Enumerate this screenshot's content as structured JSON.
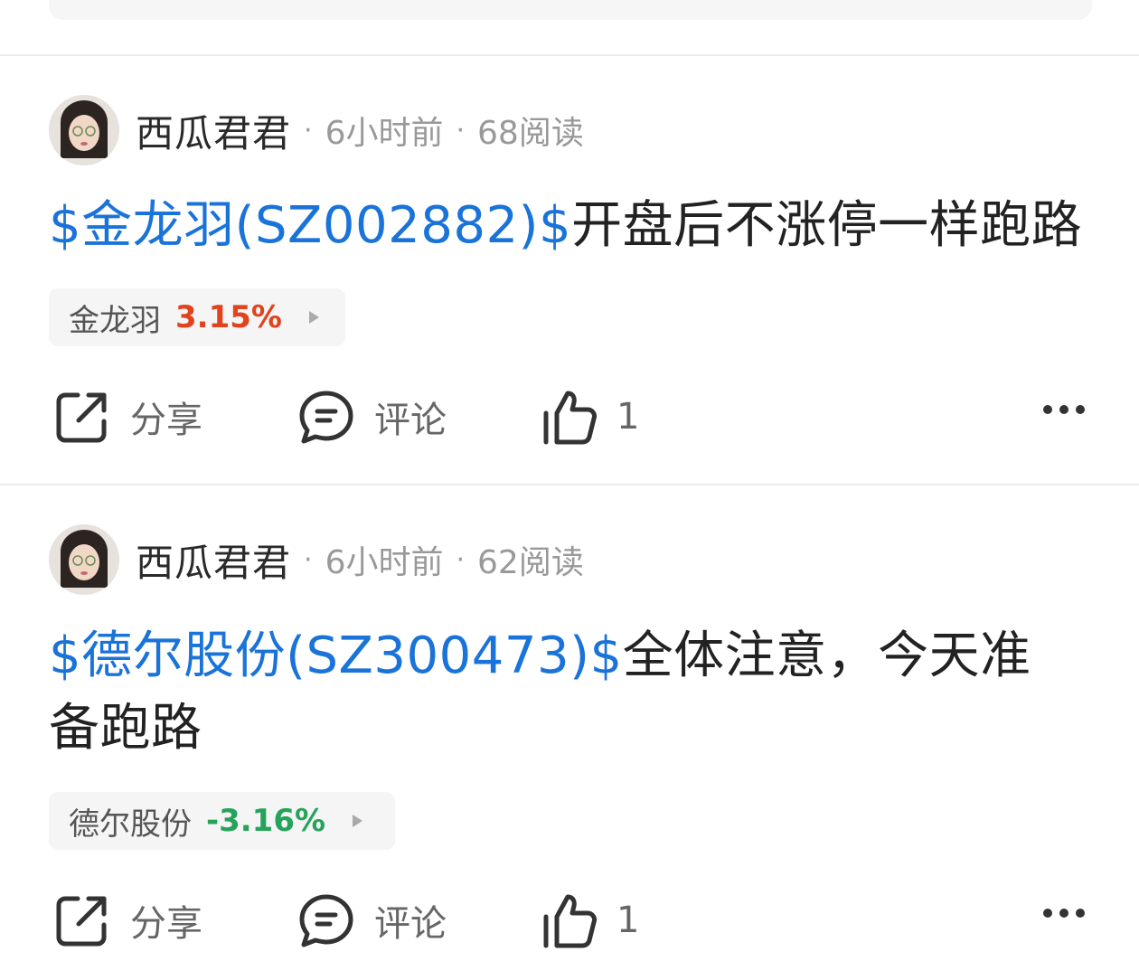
{
  "posts": [
    {
      "author": "西瓜君君",
      "time": "6小时前",
      "reads": "68阅读",
      "stock_link": "$金龙羽(SZ002882)$",
      "text": "开盘后不涨停一样跑路",
      "chip": {
        "name": "金龙羽",
        "change": "3.15%",
        "direction": "up"
      },
      "actions": {
        "share": "分享",
        "comment": "评论",
        "likes": "1"
      }
    },
    {
      "author": "西瓜君君",
      "time": "6小时前",
      "reads": "62阅读",
      "stock_link": "$德尔股份(SZ300473)$",
      "text": "全体注意，今天准备跑路",
      "chip": {
        "name": "德尔股份",
        "change": "-3.16%",
        "direction": "down"
      },
      "actions": {
        "share": "分享",
        "comment": "评论",
        "likes": "1"
      }
    }
  ],
  "colors": {
    "link": "#1a73d9",
    "up": "#e0431e",
    "down": "#26a35b"
  },
  "icons": [
    "share-icon",
    "comment-icon",
    "thumbs-up-icon",
    "more-icon"
  ]
}
